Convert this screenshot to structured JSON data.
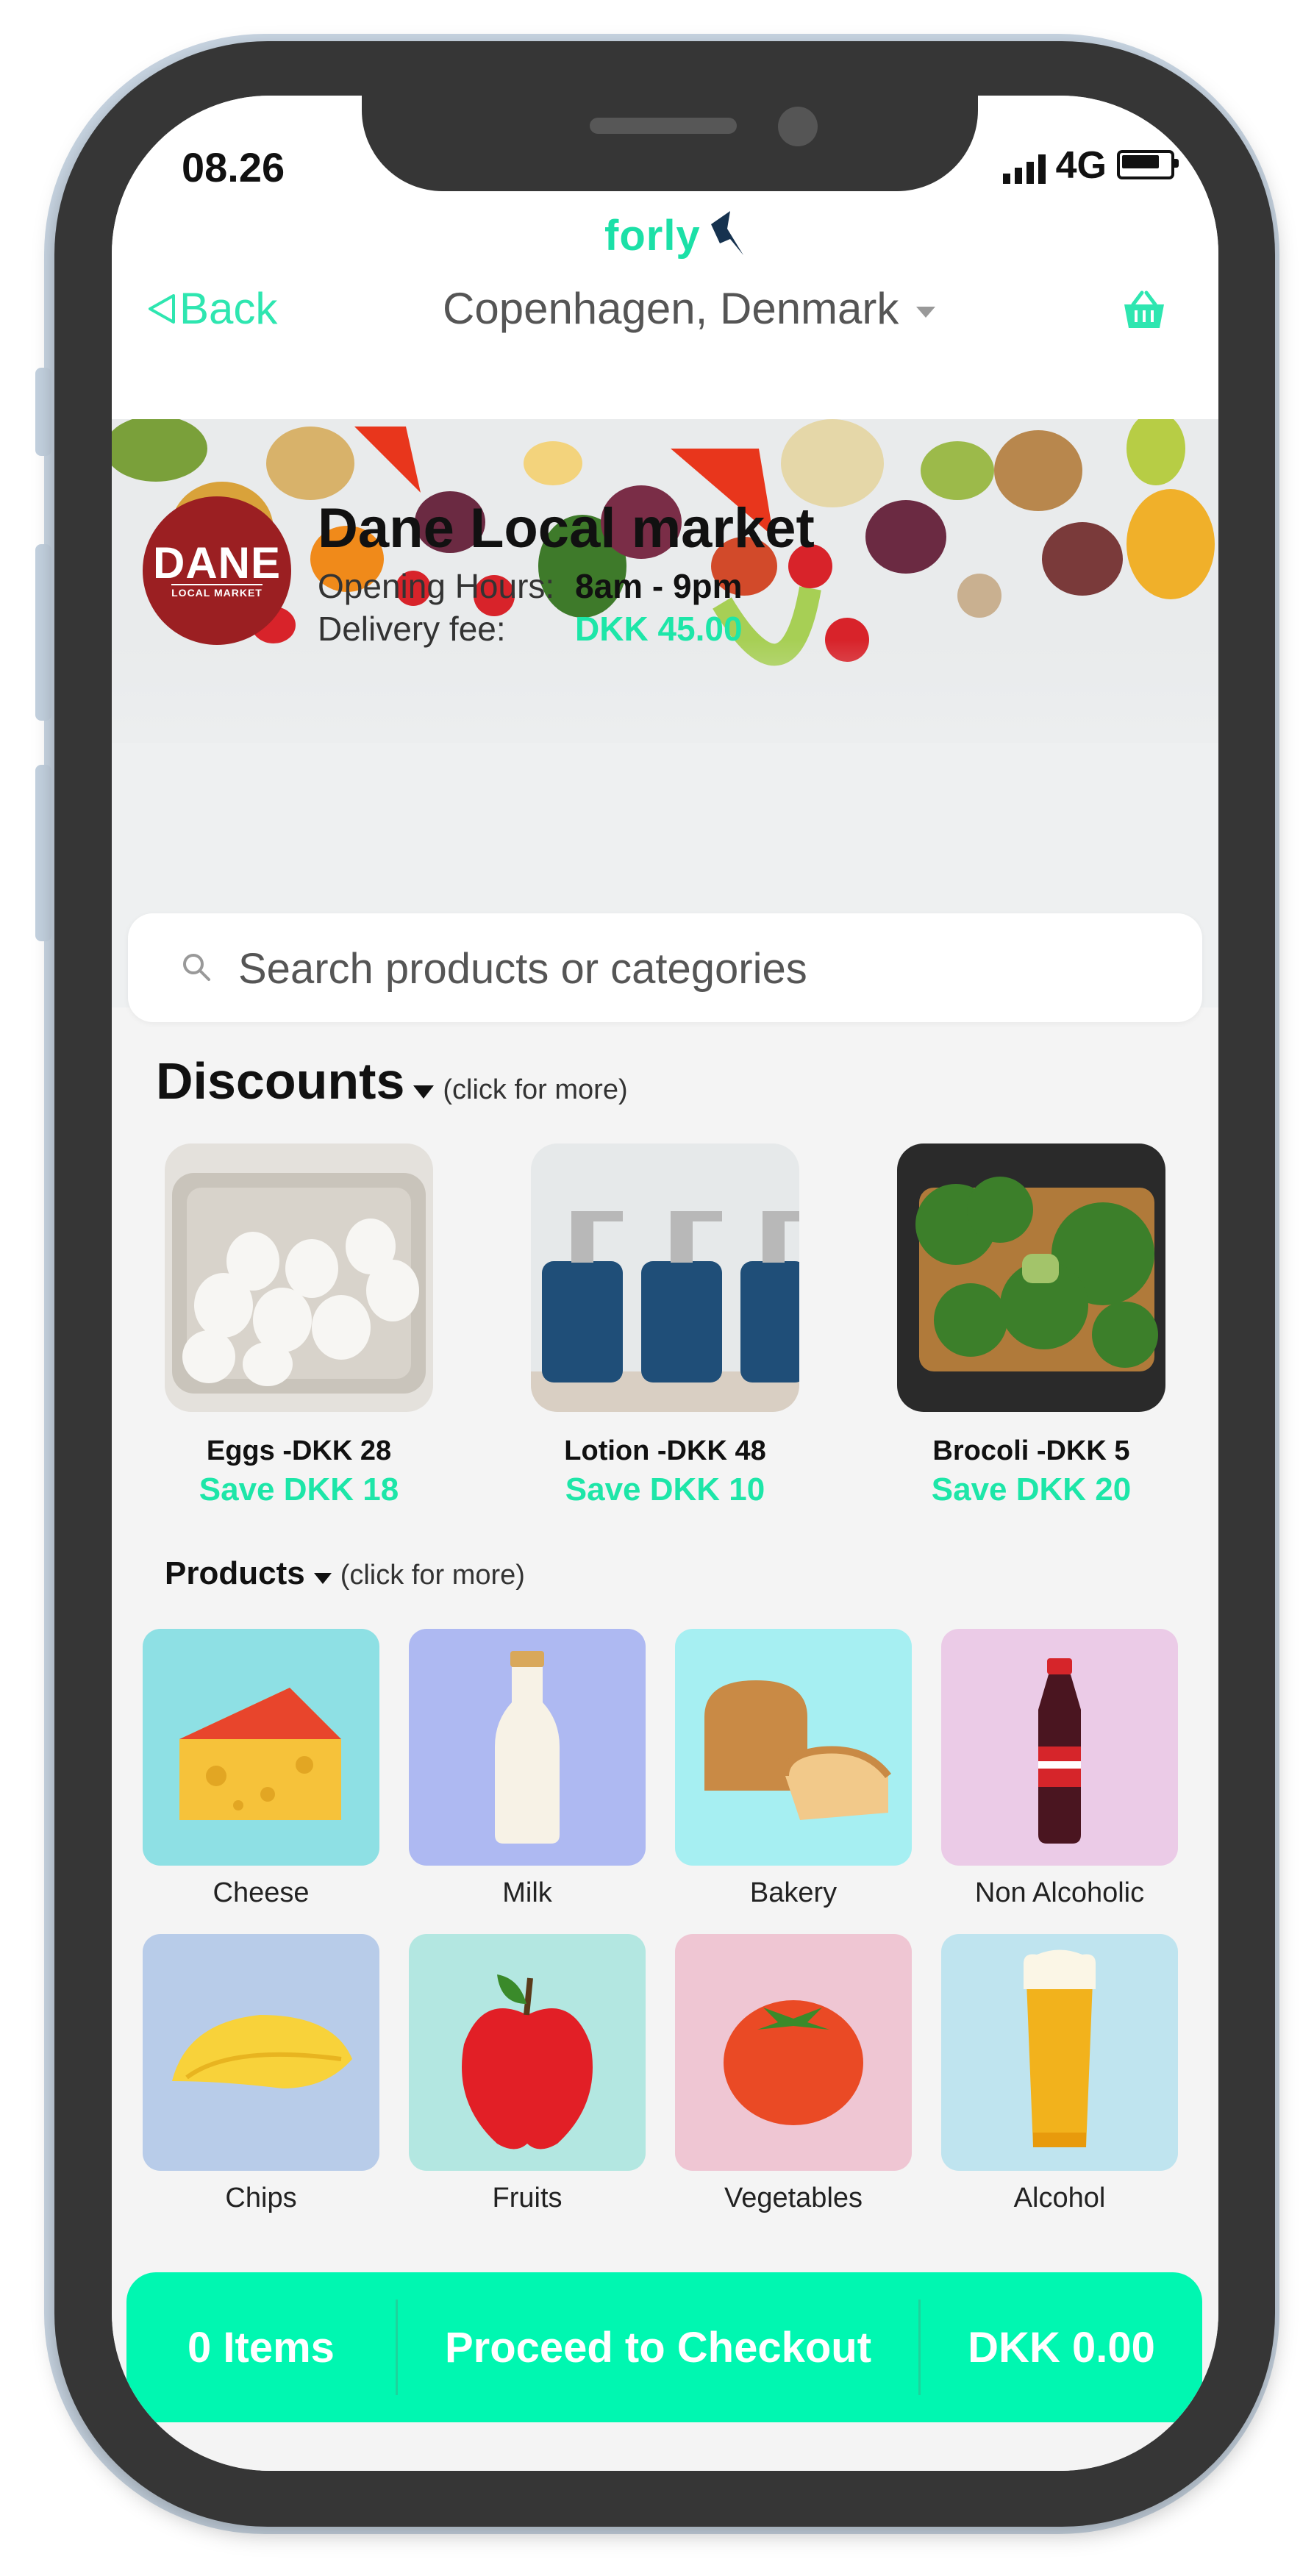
{
  "status_bar": {
    "time": "08.26",
    "network": "4G"
  },
  "header": {
    "brand": "forly",
    "back_label": "Back",
    "location": "Copenhagen, Denmark"
  },
  "store": {
    "logo_text": "DANE",
    "logo_subtext": "LOCAL MARKET",
    "name": "Dane Local market",
    "hours_label": "Opening Hours:",
    "hours_value": "8am - 9pm",
    "fee_label": "Delivery fee:",
    "fee_value": "DKK 45.00"
  },
  "search": {
    "placeholder": "Search products or categories"
  },
  "discounts": {
    "title": "Discounts",
    "more": "(click for more)",
    "items": [
      {
        "name": "Eggs -DKK 28",
        "save": "Save DKK 18"
      },
      {
        "name": "Lotion -DKK 48",
        "save": "Save DKK 10"
      },
      {
        "name": "Brocoli -DKK 5",
        "save": "Save DKK 20"
      }
    ]
  },
  "products": {
    "title": "Products",
    "more": "(click for more)",
    "items": [
      {
        "label": "Cheese",
        "color": "#8ee0e4"
      },
      {
        "label": "Milk",
        "color": "#aeb9f2"
      },
      {
        "label": "Bakery",
        "color": "#a6eff2"
      },
      {
        "label": "Non Alcoholic",
        "color": "#ebcbe7"
      },
      {
        "label": "Chips",
        "color": "#b8cce9"
      },
      {
        "label": "Fruits",
        "color": "#b3e7e1"
      },
      {
        "label": "Vegetables",
        "color": "#efc6d3"
      },
      {
        "label": "Alcohol",
        "color": "#bfe4ef"
      }
    ]
  },
  "checkout": {
    "items": "0 Items",
    "proceed": "Proceed to Checkout",
    "total": "DKK 0.00"
  },
  "colors": {
    "accent": "#1de6a8",
    "checkout_bg": "#00f7b1",
    "logo_red": "#9b1f22"
  }
}
